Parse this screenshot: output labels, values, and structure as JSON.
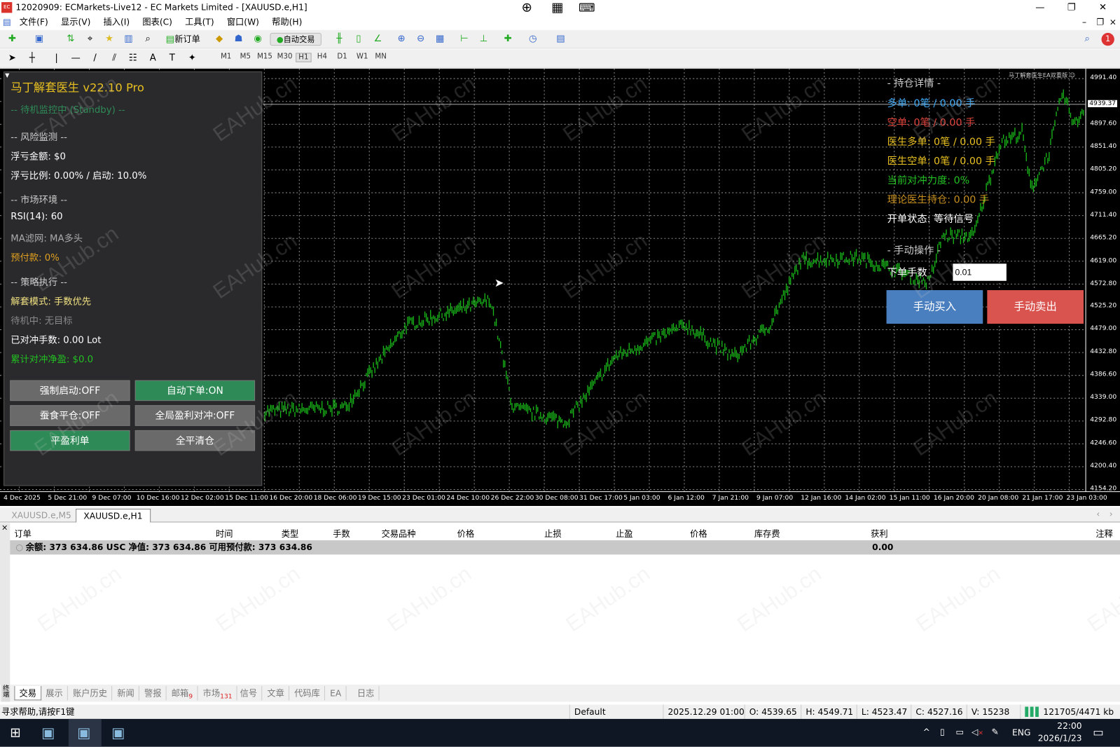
{
  "window": {
    "title": "12020909: ECMarkets-Live12 - EC Markets Limited - [XAUUSD.e,H1]",
    "logo": "EC",
    "minimize": "—",
    "restore": "❐",
    "close": "✕"
  },
  "menu": [
    "文件(F)",
    "显示(V)",
    "插入(I)",
    "图表(C)",
    "工具(T)",
    "窗口(W)",
    "帮助(H)"
  ],
  "toolbar": {
    "new_order": "新订单",
    "auto_trading": "自动交易",
    "timeframes": [
      "M1",
      "M5",
      "M15",
      "M30",
      "H1",
      "H4",
      "D1",
      "W1",
      "MN"
    ],
    "active_timeframe": "H1",
    "notification_count": "1"
  },
  "panel": {
    "title": "马丁解套医生 v22.10 Pro",
    "status": "-- 待机监控中 (Standby) --",
    "sec_risk": "-- 风险监测 --",
    "float_amount": "浮亏金额: $0",
    "float_ratio": "浮亏比例: 0.00% / 启动: 10.0%",
    "sec_market": "-- 市场环境 --",
    "rsi": "RSI(14): 60",
    "ma": "MA滤网: MA多头",
    "prepay": "预付款: 0%",
    "sec_strategy": "-- 策略执行 --",
    "mode": "解套模式: 手数优先",
    "standby": "待机中: 无目标",
    "hedged": "已对冲手数: 0.00 Lot",
    "net": "累计对冲净盈: $0.0",
    "buttons": [
      "强制启动:OFF",
      "自动下单:ON",
      "蚕食平仓:OFF",
      "全局盈利对冲:OFF",
      "平盈利单",
      "全平清仓"
    ]
  },
  "right": {
    "ea_label": "马丁解套医生EA双重版 ☺",
    "sec_positions": "- 持仓详情 -",
    "long": "多单: 0笔 / 0.00 手",
    "short": "空单: 0笔 / 0.00 手",
    "doc_long": "医生多单: 0笔 / 0.00 手",
    "doc_short": "医生空单: 0笔 / 0.00 手",
    "hedge_strength": "当前对冲力度: 0%",
    "theory": "理论医生持仓: 0.00 手",
    "order_status": "开单状态: 等待信号",
    "sec_manual": "- 手动操作 -",
    "lot_label": "下单手数",
    "lot_value": "0.01",
    "buy": "手动买入",
    "sell": "手动卖出"
  },
  "colors": {
    "bull": "#19b819",
    "buy": "#4a7fbf",
    "sell": "#d9534f",
    "panel_title": "#e8c020",
    "long": "#3fa9f5",
    "short": "#e0443c",
    "doctor": "#e8c020",
    "green_text": "#22c022",
    "orange": "#c89020"
  },
  "chart_data": {
    "type": "bar",
    "symbol": "XAUUSD.e",
    "timeframe": "H1",
    "current_price": "4939.37",
    "price_ticks": [
      "4991.40",
      "4897.60",
      "4851.40",
      "4805.20",
      "4759.00",
      "4711.40",
      "4665.20",
      "4619.00",
      "4572.80",
      "4525.20",
      "4479.00",
      "4432.80",
      "4386.60",
      "4339.00",
      "4292.80",
      "4246.60",
      "4200.40",
      "4154.20"
    ],
    "ylim": [
      4154.2,
      4991.4
    ],
    "time_labels": [
      "4 Dec 2025",
      "5 Dec 21:00",
      "9 Dec 07:00",
      "10 Dec 16:00",
      "12 Dec 02:00",
      "15 Dec 11:00",
      "16 Dec 20:00",
      "18 Dec 06:00",
      "19 Dec 15:00",
      "23 Dec 01:00",
      "24 Dec 10:00",
      "26 Dec 22:00",
      "30 Dec 08:00",
      "31 Dec 17:00",
      "5 Jan 03:00",
      "6 Jan 12:00",
      "7 Jan 21:00",
      "9 Jan 07:00",
      "12 Jan 16:00",
      "14 Jan 02:00",
      "15 Jan 11:00",
      "16 Jan 20:00",
      "20 Jan 08:00",
      "21 Jan 17:00",
      "23 Jan 03:00"
    ],
    "price_path": [
      [
        5.9,
        4314
      ],
      [
        7.7,
        4321
      ],
      [
        9.1,
        4489
      ],
      [
        11.0,
        4540
      ],
      [
        11.5,
        4321
      ],
      [
        12.7,
        4292
      ],
      [
        13.8,
        4424
      ],
      [
        15.4,
        4489
      ],
      [
        16.5,
        4424
      ],
      [
        17.3,
        4489
      ],
      [
        18.0,
        4620
      ],
      [
        19.3,
        4627
      ],
      [
        20.9,
        4576
      ],
      [
        21.2,
        4671
      ],
      [
        21.9,
        4671
      ],
      [
        22.5,
        4860
      ],
      [
        23.0,
        4882
      ],
      [
        23.2,
        4766
      ],
      [
        23.6,
        4838
      ],
      [
        23.9,
        4962
      ],
      [
        24.2,
        4897
      ],
      [
        24.4,
        4933
      ]
    ]
  },
  "chart_tabs": [
    "XAUUSD.e,M5",
    "XAUUSD.e,H1"
  ],
  "terminal": {
    "headers": [
      "订单",
      "时间",
      "类型",
      "手数",
      "交易品种",
      "价格",
      "止损",
      "止盈",
      "价格",
      "库存费",
      "获利",
      "注释"
    ],
    "balance_row": "余额: 373 634.86 USC  净值: 373 634.86  可用预付款: 373 634.86",
    "profit": "0.00",
    "side_label": "终端",
    "tabs": [
      "交易",
      "展示",
      "账户历史",
      "新闻",
      "警报",
      "邮箱",
      "市场",
      "信号",
      "文章",
      "代码库",
      "EA",
      "日志"
    ],
    "mail_badge": "9",
    "market_badge": "131"
  },
  "status": {
    "help": "寻求帮助,请按F1键",
    "profile": "Default",
    "time": "2025.12.29 01:00",
    "open": "O: 4539.65",
    "high": "H: 4549.71",
    "low": "L: 4523.47",
    "close": "C: 4527.16",
    "volume": "V: 15238",
    "traffic": "121705/4471 kb"
  },
  "taskbar": {
    "lang": "ENG",
    "time": "22:00",
    "date": "2026/1/23"
  },
  "watermark": "EAHub.cn"
}
